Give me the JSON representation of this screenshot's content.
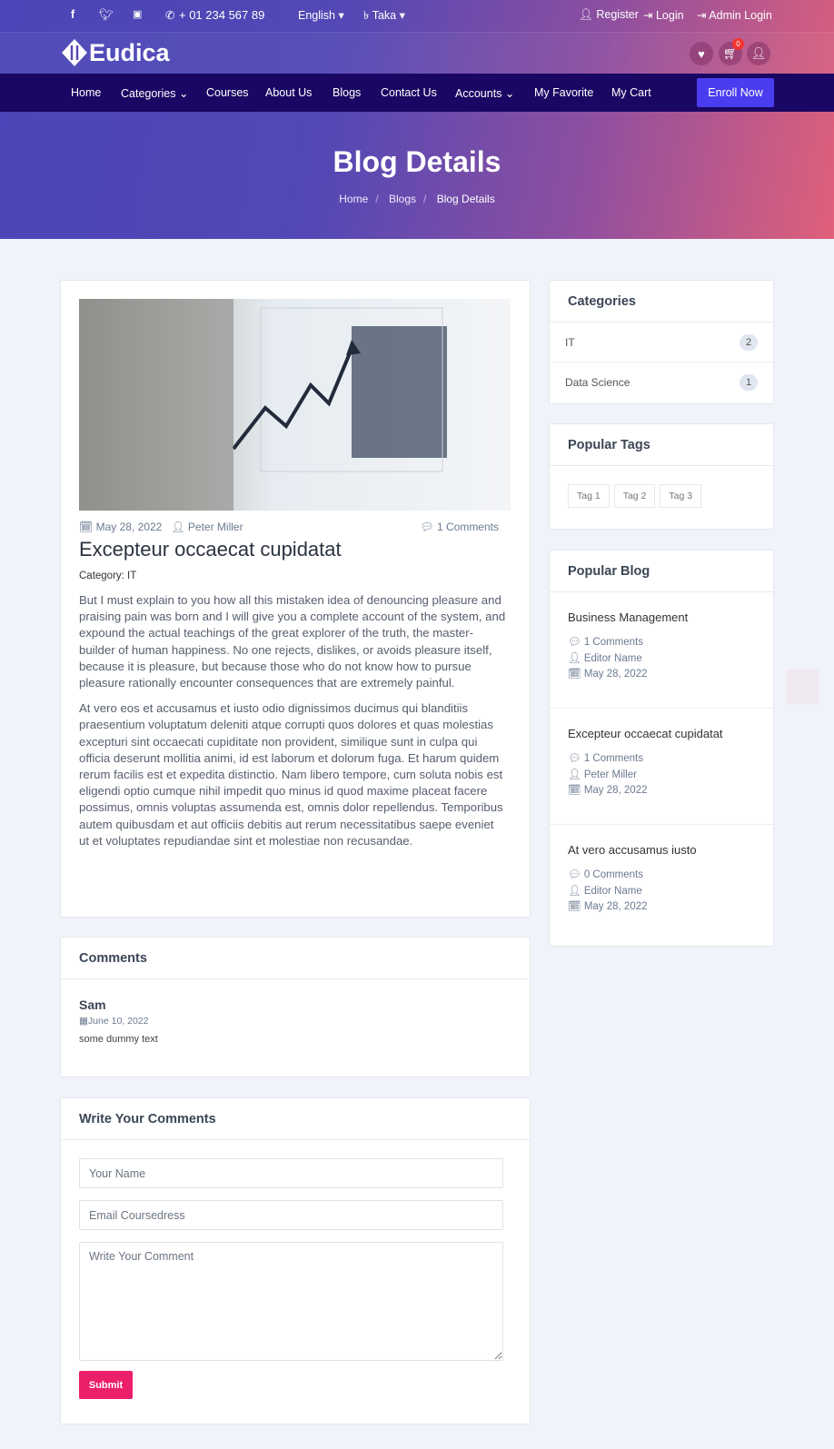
{
  "topbar": {
    "phone": "+ 01 234 567 89",
    "language": "English",
    "currency": "Taka",
    "register": "Register",
    "login": "Login",
    "admin_login": "Admin Login"
  },
  "header": {
    "logo": "Eudica",
    "cart_count": "0"
  },
  "nav": {
    "items": [
      "Home",
      "Categories",
      "Courses",
      "About Us",
      "Blogs",
      "Contact Us",
      "Accounts",
      "My Favorite",
      "My Cart"
    ],
    "enroll": "Enroll Now"
  },
  "hero": {
    "title": "Blog Details",
    "breadcrumb": [
      "Home",
      "Blogs",
      "Blog Details"
    ]
  },
  "post": {
    "date": "May 28, 2022",
    "author": "Peter Miller",
    "comments": "1 Comments",
    "title": "Excepteur occaecat cupidatat",
    "category": "Category: IT",
    "p1": "But I must explain to you how all this mistaken idea of denouncing pleasure and praising pain was born and I will give you a complete account of the system, and expound the actual teachings of the great explorer of the truth, the master-builder of human happiness. No one rejects, dislikes, or avoids pleasure itself, because it is pleasure, but because those who do not know how to pursue pleasure rationally encounter consequences that are extremely painful.",
    "p2": "At vero eos et accusamus et iusto odio dignissimos ducimus qui blanditiis praesentium voluptatum deleniti atque corrupti quos dolores et quas molestias excepturi sint occaecati cupiditate non provident, similique sunt in culpa qui officia deserunt mollitia animi, id est laborum et dolorum fuga. Et harum quidem rerum facilis est et expedita distinctio. Nam libero tempore, cum soluta nobis est eligendi optio cumque nihil impedit quo minus id quod maxime placeat facere possimus, omnis voluptas assumenda est, omnis dolor repellendus. Temporibus autem quibusdam et aut officiis debitis aut rerum necessitatibus saepe eveniet ut et voluptates repudiandae sint et molestiae non recusandae."
  },
  "comments": {
    "title": "Comments",
    "items": [
      {
        "name": "Sam",
        "date": "June 10, 2022",
        "text": "some dummy text"
      }
    ]
  },
  "form": {
    "title": "Write Your Comments",
    "name_ph": "Your Name",
    "email_ph": "Email Coursedress",
    "comment_ph": "Write Your Comment",
    "submit": "Submit"
  },
  "sidebar": {
    "categories_title": "Categories",
    "categories": [
      {
        "name": "IT",
        "count": "2"
      },
      {
        "name": "Data Science",
        "count": "1"
      }
    ],
    "tags_title": "Popular Tags",
    "tags": [
      "Tag 1",
      "Tag 2",
      "Tag 3"
    ],
    "popular_title": "Popular Blog",
    "popular": [
      {
        "title": "Business Management",
        "comments": "1 Comments",
        "author": "Editor Name",
        "date": "May 28, 2022"
      },
      {
        "title": "Excepteur occaecat cupidatat",
        "comments": "1 Comments",
        "author": "Peter Miller",
        "date": "May 28, 2022"
      },
      {
        "title": "At vero accusamus iusto",
        "comments": "0 Comments",
        "author": "Editor Name",
        "date": "May 28, 2022"
      }
    ]
  }
}
